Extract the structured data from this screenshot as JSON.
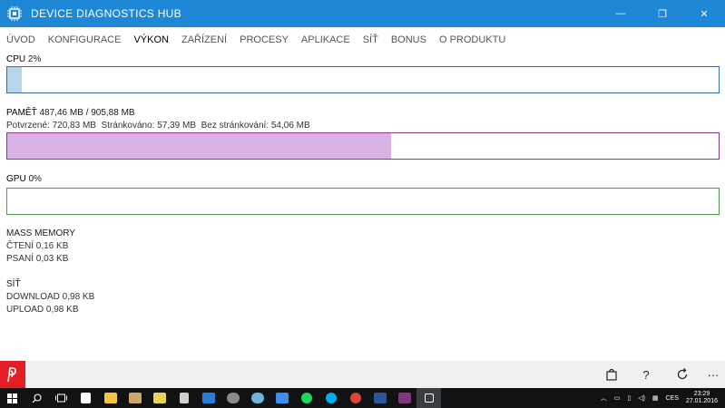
{
  "window": {
    "title": "DEVICE DIAGNOSTICS HUB",
    "minimize_glyph": "—",
    "maximize_glyph": "❐",
    "close_glyph": "✕"
  },
  "nav": {
    "items": [
      {
        "label": "ÚVOD",
        "active": false
      },
      {
        "label": "KONFIGURACE",
        "active": false
      },
      {
        "label": "VÝKON",
        "active": true
      },
      {
        "label": "ZAŘÍZENÍ",
        "active": false
      },
      {
        "label": "PROCESY",
        "active": false
      },
      {
        "label": "APLIKACE",
        "active": false
      },
      {
        "label": "SÍŤ",
        "active": false
      },
      {
        "label": "BONUS",
        "active": false
      },
      {
        "label": "O PRODUKTU",
        "active": false
      }
    ]
  },
  "cpu": {
    "label": "CPU",
    "value": "2%",
    "fill_percent": 2,
    "border_color": "#3a6ea5",
    "fill_color": "#b4d5ea"
  },
  "memory": {
    "label": "PAMĚŤ",
    "value": "487,46 MB / 905,88 MB",
    "committed": "Potvrzené: 720,83 MB",
    "paged": "Stránkováno: 57,39 MB",
    "nonpaged": "Bez stránkování: 54,06 MB",
    "fill_percent": 54,
    "border_color": "#8a3a8a",
    "fill_color": "#d9b3e6"
  },
  "gpu": {
    "label": "GPU",
    "value": "0%",
    "fill_percent": 0,
    "border_color": "#4f9a4f"
  },
  "mass_memory": {
    "title": "MASS MEMORY",
    "read": "ČTENÍ 0,16 KB",
    "write": "PSANÍ 0,03 KB"
  },
  "network": {
    "title": "SÍŤ",
    "download": "DOWNLOAD 0,98 KB",
    "upload": "UPLOAD 0,98 KB"
  },
  "appbar": {
    "icons": [
      "store-bag-icon",
      "help-icon",
      "refresh-icon",
      "more-icon"
    ],
    "help_glyph": "?",
    "more_glyph": "···"
  },
  "taskbar": {
    "icons": [
      "windows-start-icon",
      "search-icon",
      "task-view-icon",
      "store-icon",
      "file-explorer-icon",
      "media-icon",
      "folder-icon",
      "calculator-icon",
      "weather-icon",
      "app-icon",
      "browser-icon",
      "dropbox-icon",
      "spotify-icon",
      "skype-icon",
      "chrome-icon",
      "word-icon",
      "onenote-icon",
      "diagnostics-icon"
    ],
    "language": "CES",
    "time": "23:29",
    "date": "27.01.2016"
  },
  "colors": {
    "titlebar": "#1e88d6",
    "accent_red": "#e31e24",
    "taskbar": "#101214"
  }
}
